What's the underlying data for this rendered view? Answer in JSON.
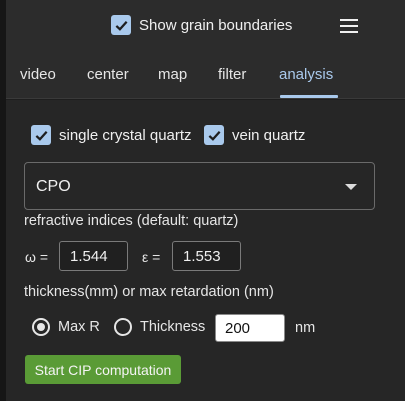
{
  "header": {
    "grain_boundaries_label": "Show grain boundaries",
    "grain_boundaries_checked": true,
    "menu_icon": "hamburger-menu-icon"
  },
  "tabs": [
    {
      "label": "video",
      "active": false
    },
    {
      "label": "center",
      "active": false
    },
    {
      "label": "map",
      "active": false
    },
    {
      "label": "filter",
      "active": false
    },
    {
      "label": "analysis",
      "active": true
    }
  ],
  "analysis": {
    "minerals": [
      {
        "label": "single crystal quartz",
        "checked": true
      },
      {
        "label": "vein quartz",
        "checked": true
      }
    ],
    "mode_select": {
      "value": "CPO"
    },
    "refractive_caption": "refractive indices (default: quartz)",
    "omega": {
      "label": "ω =",
      "value": "1.544"
    },
    "epsilon": {
      "label": "ε =",
      "value": "1.553"
    },
    "thickness_caption": "thickness(mm) or max retardation (nm)",
    "radios": [
      {
        "label": "Max R",
        "selected": true
      },
      {
        "label": "Thickness",
        "selected": false
      }
    ],
    "thickness_value": "200",
    "unit": "nm",
    "start_button": "Start CIP computation"
  },
  "colors": {
    "accent": "#a9c9ec",
    "button_green": "#5a9b36",
    "background": "#262626"
  }
}
